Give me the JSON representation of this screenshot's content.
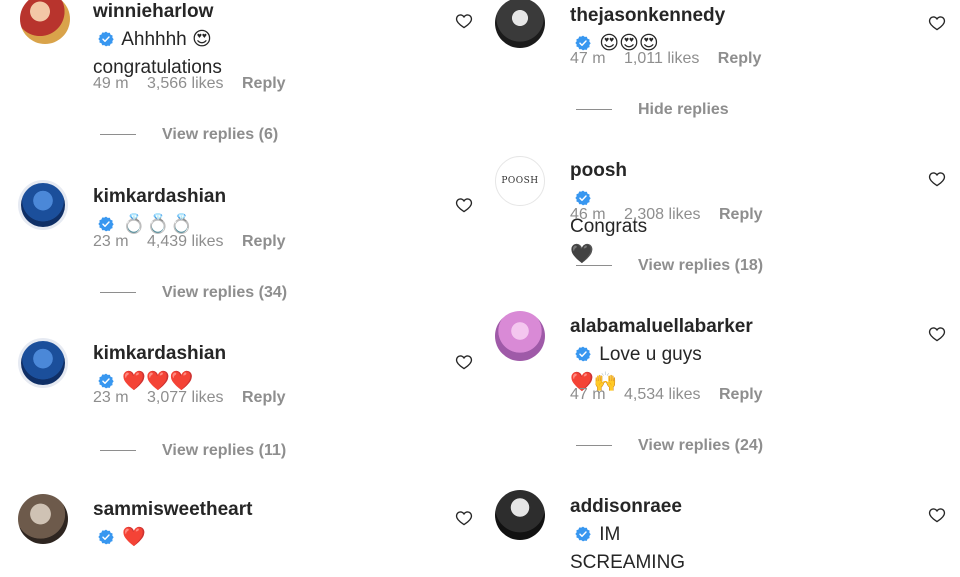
{
  "left_column": [
    {
      "username": "winnieharlow",
      "text_line1": "Ahhhhh 😍",
      "text_line2": "congratulations",
      "time": "49 m",
      "likes": "3,566 likes",
      "reply": "Reply",
      "replies": "View replies (6)"
    },
    {
      "username": "kimkardashian",
      "text_line1": "💍💍💍",
      "time": "23 m",
      "likes": "4,439 likes",
      "reply": "Reply",
      "replies": "View replies (34)"
    },
    {
      "username": "kimkardashian",
      "text_line1": "❤️❤️❤️",
      "time": "23 m",
      "likes": "3,077 likes",
      "reply": "Reply",
      "replies": "View replies (11)"
    },
    {
      "username": "sammisweetheart",
      "text_line1": "❤️"
    }
  ],
  "right_column": [
    {
      "username": "thejasonkennedy",
      "text_line1": "😍😍😍",
      "time": "47 m",
      "likes": "1,011 likes",
      "reply": "Reply",
      "replies": "Hide replies"
    },
    {
      "username": "poosh",
      "avatar_text": "POOSH",
      "text_line1": "Congrats 🖤",
      "time": "46 m",
      "likes": "2,308 likes",
      "reply": "Reply",
      "replies": "View replies (18)"
    },
    {
      "username": "alabamaluellabarker",
      "text_line1": "Love u guys",
      "text_line2": "❤️🙌",
      "time": "47 m",
      "likes": "4,534 likes",
      "reply": "Reply",
      "replies": "View replies (24)"
    },
    {
      "username": "addisonraee",
      "text_line1": "IM SCREAMING"
    }
  ],
  "colors": {
    "text": "#262626",
    "secondary": "#8e8e8e",
    "verified": "#3897f0"
  },
  "icons": {
    "verified": "verified-badge-icon",
    "like": "heart-outline-icon"
  }
}
